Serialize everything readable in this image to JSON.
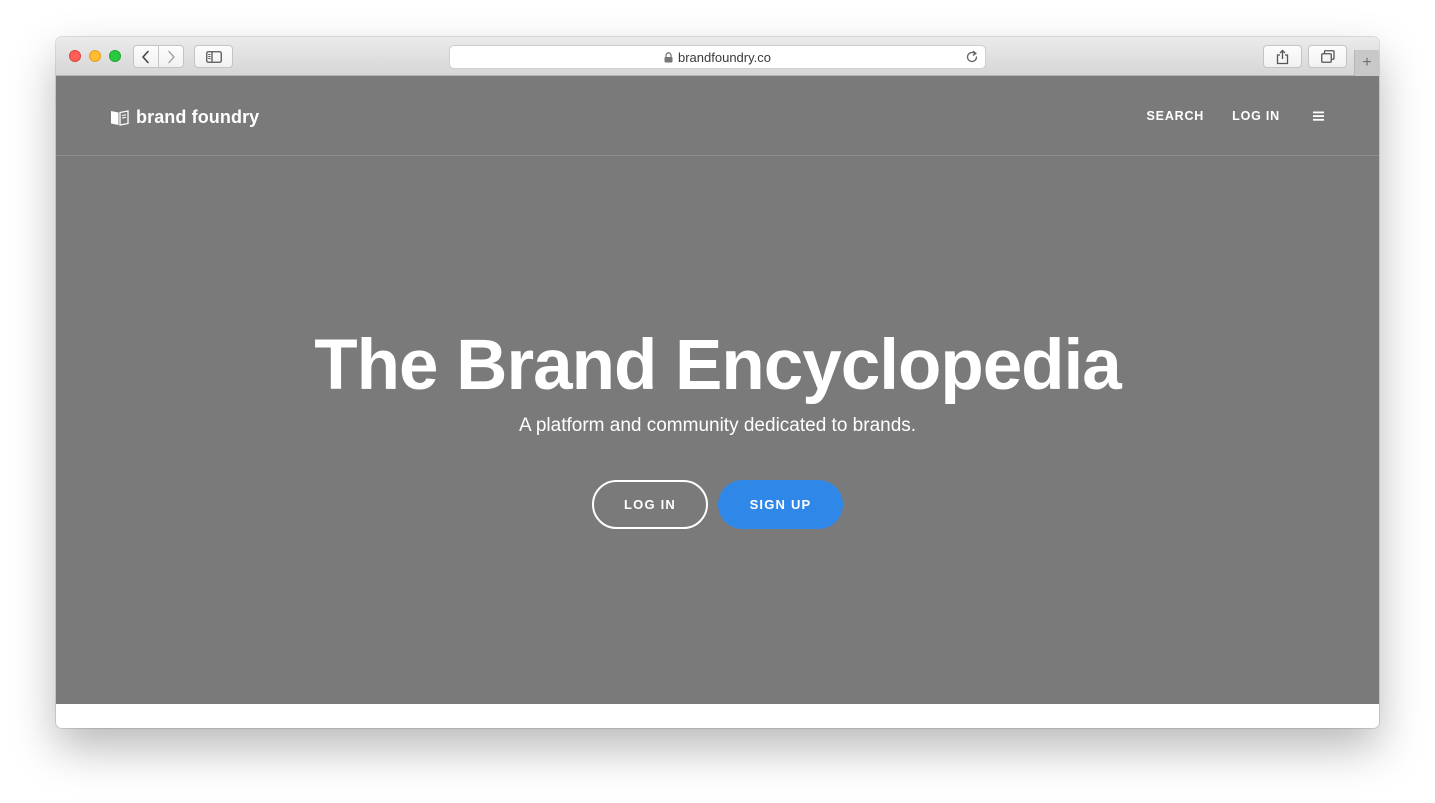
{
  "browser": {
    "url": "brandfoundry.co",
    "new_tab_symbol": "+"
  },
  "site": {
    "logo_text": "brand foundry",
    "nav": {
      "search": "SEARCH",
      "login": "LOG IN"
    }
  },
  "hero": {
    "title": "The Brand Encyclopedia",
    "subtitle": "A platform and community dedicated to brands.",
    "login_button": "LOG IN",
    "signup_button": "SIGN UP"
  },
  "colors": {
    "page_background": "#7a7a7a",
    "accent": "#2f88e8",
    "text": "#ffffff"
  }
}
